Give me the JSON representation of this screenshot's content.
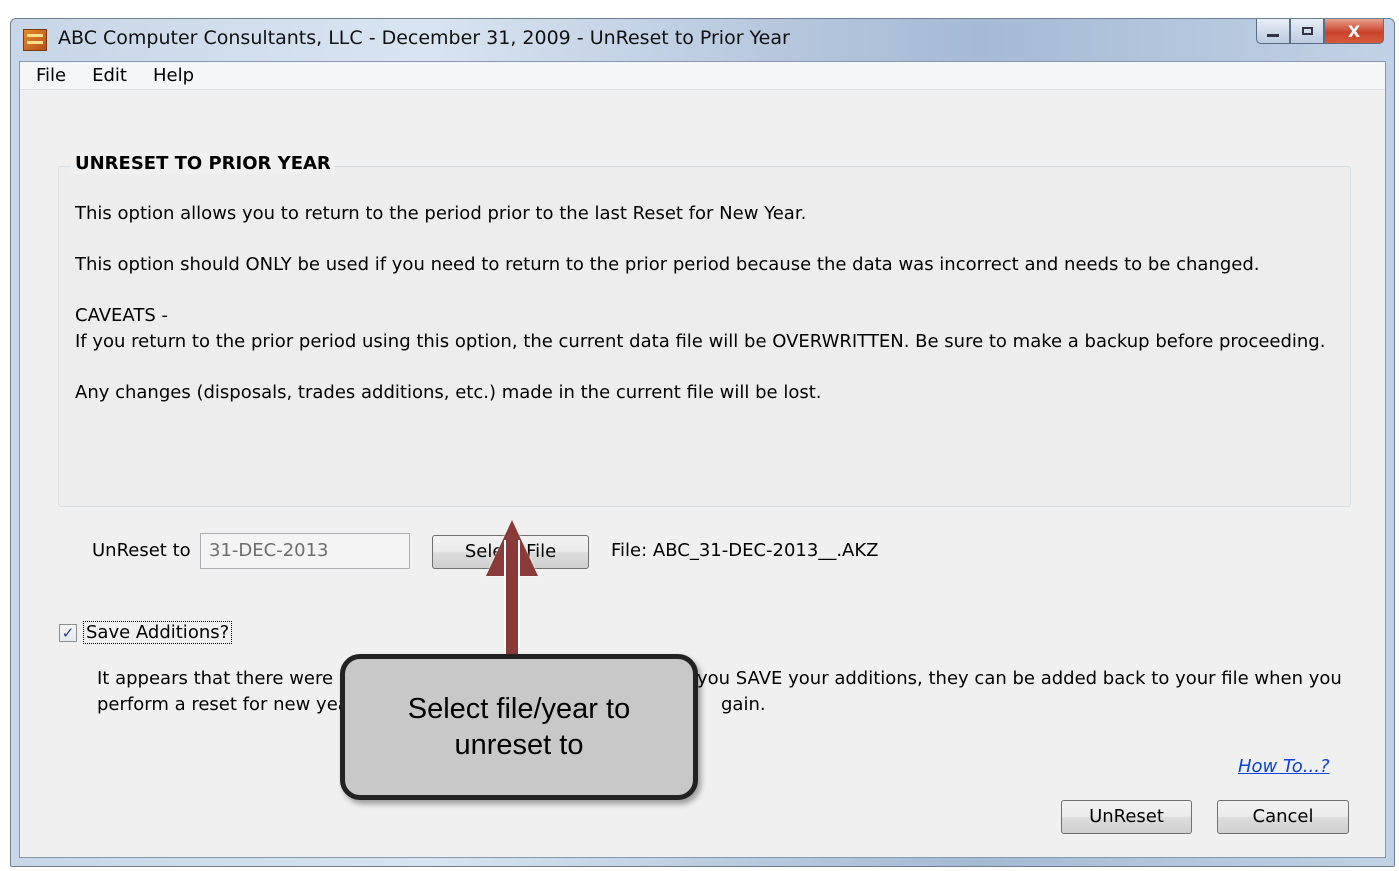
{
  "window": {
    "title": "ABC Computer Consultants, LLC - December 31, 2009 - UnReset to Prior Year",
    "controls": {
      "close": "X"
    }
  },
  "menu": [
    "File",
    "Edit",
    "Help"
  ],
  "group": {
    "title": "UNRESET TO PRIOR YEAR",
    "line1": "This option allows you to return to the period prior to the last Reset for New Year.",
    "line2": "This option should ONLY be used if you need to return to the prior period because the data was incorrect and needs to be changed.",
    "caveats_heading": "CAVEATS -",
    "caveat1": "If you return to the prior period using this option, the current data file will be OVERWRITTEN.  Be sure to make a backup before proceeding.",
    "caveat2": "Any changes (disposals, trades additions, etc.) made in the current file will be lost."
  },
  "unreset": {
    "label": "UnReset to",
    "date_value": "31-DEC-2013",
    "select_button": "Select File",
    "file_label": "File:  ABC_31-DEC-2013__.AKZ"
  },
  "save_additions": {
    "checked": true,
    "check_glyph": "✓",
    "label": "Save Additions?",
    "info_line1": "It appears that there were N",
    "info_line1_end": "you SAVE your additions, they can be added back to your file when you",
    "info_line2": "perform a reset for new yea",
    "info_line2_end": "gain."
  },
  "links": {
    "how_to": "How To...?"
  },
  "buttons": {
    "unreset": "UnReset",
    "cancel": "Cancel"
  },
  "callout": {
    "text": "Select file/year to unreset to"
  }
}
